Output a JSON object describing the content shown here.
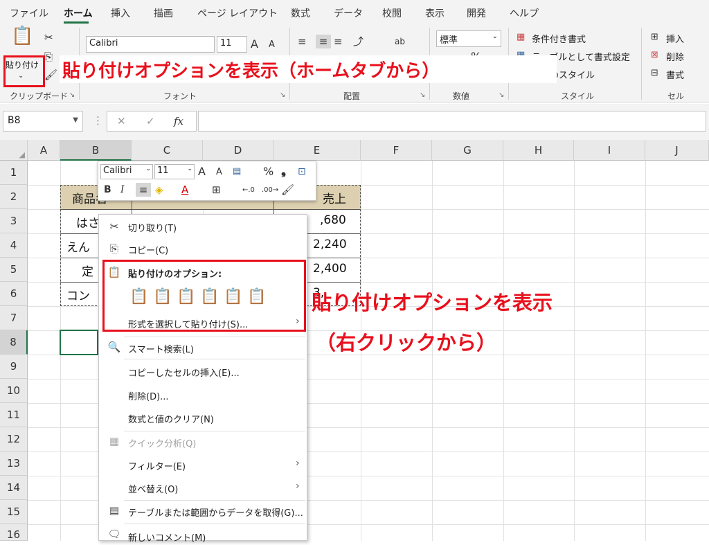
{
  "tabs": [
    "ファイル",
    "ホーム",
    "挿入",
    "描画",
    "ページ レイアウト",
    "数式",
    "データ",
    "校閲",
    "表示",
    "開発",
    "ヘルプ"
  ],
  "ribbon": {
    "paste_label": "貼り付け",
    "font_name": "Calibri",
    "font_size": "11",
    "font_grow": "A",
    "font_shrink": "A",
    "number_format": "標準",
    "percent": "%",
    "style_items": [
      "条件付き書式",
      "テーブルとして書式設定",
      "セルのスタイル"
    ],
    "cell_items": [
      "挿入",
      "削除",
      "書式"
    ],
    "groups": [
      "クリップボード",
      "フォント",
      "配置",
      "数値",
      "スタイル",
      "セル"
    ]
  },
  "formula_bar": {
    "name_box": "B8",
    "fx": "fx",
    "cancel": "✕",
    "enter": "✓",
    "formula": ""
  },
  "columns": [
    "A",
    "B",
    "C",
    "D",
    "E",
    "F",
    "G",
    "H",
    "I",
    "J"
  ],
  "rows": [
    "1",
    "2",
    "3",
    "4",
    "5",
    "6",
    "7",
    "8",
    "9",
    "10",
    "11",
    "12",
    "13",
    "14",
    "15",
    "16"
  ],
  "cells": {
    "b2": "商品名",
    "e2": "売上",
    "b3": "はさ",
    "e3": ",680",
    "b4": "えん",
    "e4": "2,240",
    "b5": "定",
    "e5": "2,400",
    "b6": "コン",
    "e6": "3,"
  },
  "mini_toolbar": {
    "font": "Calibri",
    "size": "11",
    "bold": "B",
    "italic": "I",
    "percent": "%"
  },
  "context_menu": {
    "cut": "切り取り(T)",
    "copy": "コピー(C)",
    "paste_options": "貼り付けのオプション:",
    "paste_special": "形式を選択して貼り付け(S)...",
    "smart_lookup": "スマート検索(L)",
    "insert_copied": "コピーしたセルの挿入(E)...",
    "delete": "削除(D)...",
    "clear": "数式と値のクリア(N)",
    "quick_analysis": "クイック分析(Q)",
    "filter": "フィルター(E)",
    "sort": "並べ替え(O)",
    "get_data": "テーブルまたは範囲からデータを取得(G)...",
    "new_comment": "新しいコメント(M)"
  },
  "annotations": {
    "ribbon": "貼り付けオプションを表示（ホームタブから）",
    "menu_line1": "貼り付けオプションを表示",
    "menu_line2": "（右クリックから）"
  },
  "colors": {
    "accent": "#217346",
    "annotation": "#e8101c",
    "header_fill": "#ddd0b0"
  }
}
